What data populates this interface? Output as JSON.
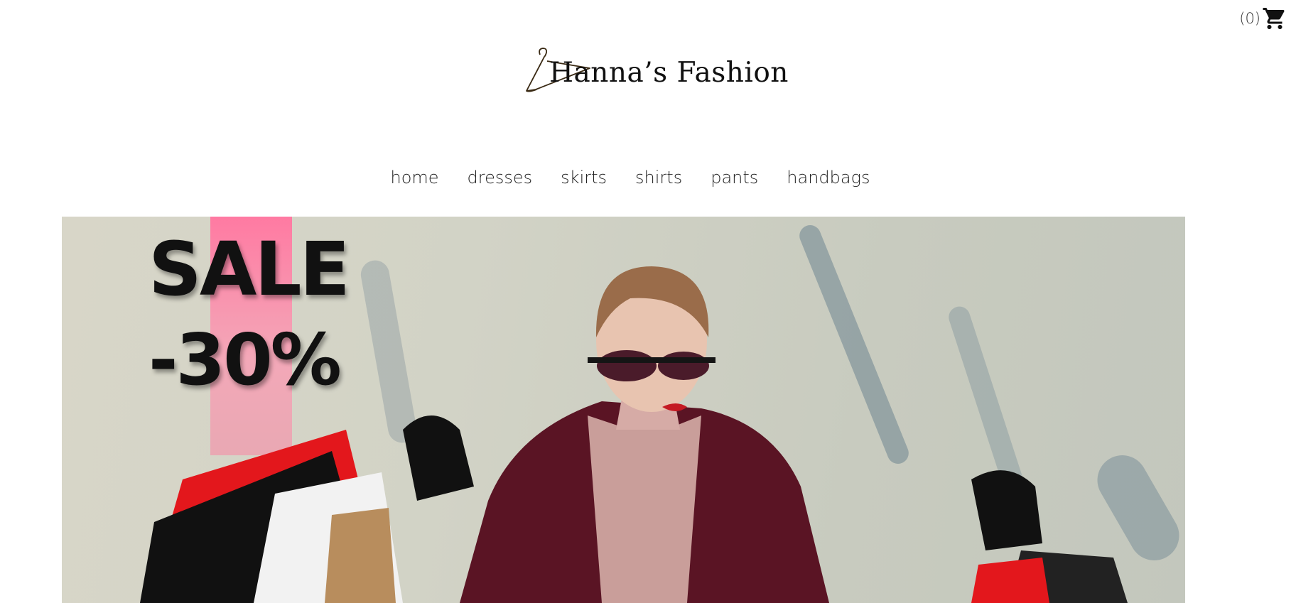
{
  "cart": {
    "count": "(0)",
    "icon": "shopping-cart-icon"
  },
  "brand": {
    "name": "Hanna’s Fashion",
    "logo_icon": "hanger-icon"
  },
  "nav": {
    "items": [
      {
        "label": "home"
      },
      {
        "label": "dresses"
      },
      {
        "label": "skirts"
      },
      {
        "label": "shirts"
      },
      {
        "label": "pants"
      },
      {
        "label": "handbags"
      }
    ]
  },
  "hero": {
    "headline": "SALE",
    "discount": "-30%",
    "accent_color": "#ff7aa2"
  }
}
